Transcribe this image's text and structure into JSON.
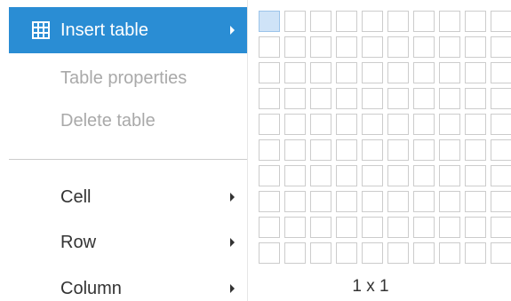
{
  "menu": {
    "insert_table": "Insert table",
    "table_properties": "Table properties",
    "delete_table": "Delete table",
    "cell": "Cell",
    "row": "Row",
    "column": "Column"
  },
  "picker": {
    "size_label": "1 x 1",
    "selected_cols": 1,
    "selected_rows": 1,
    "visible_cols": 10,
    "visible_rows": 10
  },
  "colors": {
    "accent": "#2a8dd4",
    "cell_border": "#cccccc",
    "cell_selected": "#cfe3f7",
    "disabled_text": "#a9a9a9"
  },
  "icons": {
    "insert_table": "table-icon",
    "submenu": "chevron-right-icon"
  }
}
